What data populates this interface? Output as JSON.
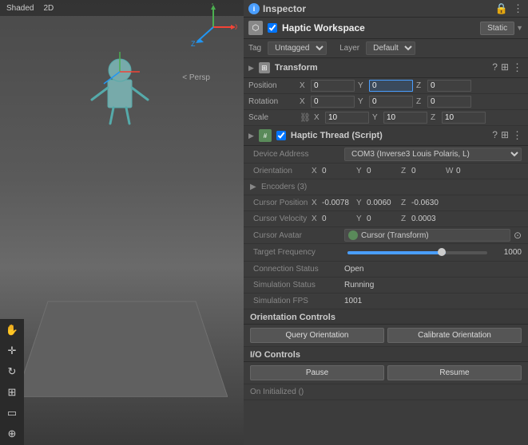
{
  "inspector": {
    "title": "Inspector",
    "icon": "i",
    "object": {
      "name": "Haptic Workspace",
      "checked": true,
      "static_label": "Static",
      "tag": "Untagged",
      "layer": "Default"
    },
    "transform": {
      "title": "Transform",
      "position": {
        "label": "Position",
        "x": "0",
        "y": "0",
        "z": "0"
      },
      "rotation": {
        "label": "Rotation",
        "x": "0",
        "y": "0",
        "z": "0"
      },
      "scale": {
        "label": "Scale",
        "x": "10",
        "y": "10",
        "z": "10"
      }
    },
    "haptic_thread": {
      "title": "Haptic Thread (Script)",
      "checked": true,
      "device_address": {
        "label": "Device Address",
        "value": "COM3 (Inverse3 Louis Polaris, L)"
      },
      "orientation": {
        "label": "Orientation",
        "x": "0",
        "y": "0",
        "z": "0",
        "w": "0"
      },
      "encoders": {
        "label": "Encoders (3)"
      },
      "cursor_position": {
        "label": "Cursor Position",
        "x": "-0.0078",
        "y": "0.0060",
        "z": "-0.0630"
      },
      "cursor_velocity": {
        "label": "Cursor Velocity",
        "x": "0",
        "y": "0",
        "z": "0.0003"
      },
      "cursor_avatar": {
        "label": "Cursor Avatar",
        "value": "Cursor (Transform)"
      },
      "target_frequency": {
        "label": "Target Frequency",
        "value": "1000"
      },
      "connection_status": {
        "label": "Connection Status",
        "value": "Open"
      },
      "simulation_status": {
        "label": "Simulation Status",
        "value": "Running"
      },
      "simulation_fps": {
        "label": "Simulation FPS",
        "value": "1001"
      },
      "orientation_controls": {
        "title": "Orientation Controls",
        "query_btn": "Query Orientation",
        "calibrate_btn": "Calibrate Orientation"
      },
      "io_controls": {
        "title": "I/O Controls",
        "pause_btn": "Pause",
        "resume_btn": "Resume"
      },
      "on_initialized": {
        "label": "On Initialized ()"
      }
    }
  },
  "viewport": {
    "labels": [
      "Shaded",
      "2D",
      "Persp"
    ],
    "persp_label": "< Persp"
  }
}
